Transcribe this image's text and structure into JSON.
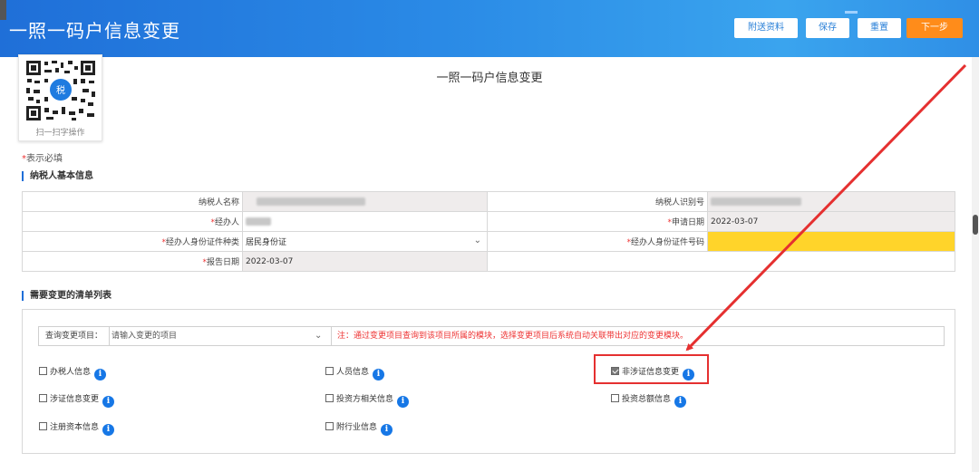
{
  "header": {
    "title": "一照一码户信息变更",
    "buttons": {
      "attach": "附送资料",
      "save": "保存",
      "reset": "重置",
      "next": "下一步"
    }
  },
  "qr": {
    "caption": "扫一扫字操作",
    "center_text": "税"
  },
  "page_title": "一照一码户信息变更",
  "required_note": {
    "star": "*",
    "text": "表示必填"
  },
  "basic_section": {
    "title": "纳税人基本信息",
    "fields": {
      "taxpayer_name_label": "纳税人名称",
      "taxpayer_id_label": "纳税人识别号",
      "handler_label": "经办人",
      "apply_date_label": "申请日期",
      "apply_date_value": "2022-03-07",
      "id_type_label": "经办人身份证件种类",
      "id_type_value": "居民身份证",
      "id_number_label": "经办人身份证件号码",
      "report_date_label": "报告日期",
      "report_date_value": "2022-03-07"
    }
  },
  "change_section": {
    "title": "需要变更的清单列表",
    "search_label": "查询变更项目：",
    "search_placeholder": "请输入变更的项目",
    "search_note": "注：通过变更项目查询到该项目所属的模块，选择变更项目后系统自动关联带出对应的变更模块。",
    "items": [
      {
        "label": "办税人信息",
        "checked": false
      },
      {
        "label": "人员信息",
        "checked": false
      },
      {
        "label": "非涉证信息变更",
        "checked": true
      },
      {
        "label": "涉证信息变更",
        "checked": false
      },
      {
        "label": "投资方相关信息",
        "checked": false
      },
      {
        "label": "投资总额信息",
        "checked": false
      },
      {
        "label": "注册资本信息",
        "checked": false
      },
      {
        "label": "附行业信息",
        "checked": false
      }
    ]
  },
  "colors": {
    "header_blue": "#2a8ae6",
    "next_orange": "#ff8c1a",
    "required_red": "#e33333",
    "info_blue": "#1677e6",
    "highlight_yellow": "#ffd42a"
  }
}
